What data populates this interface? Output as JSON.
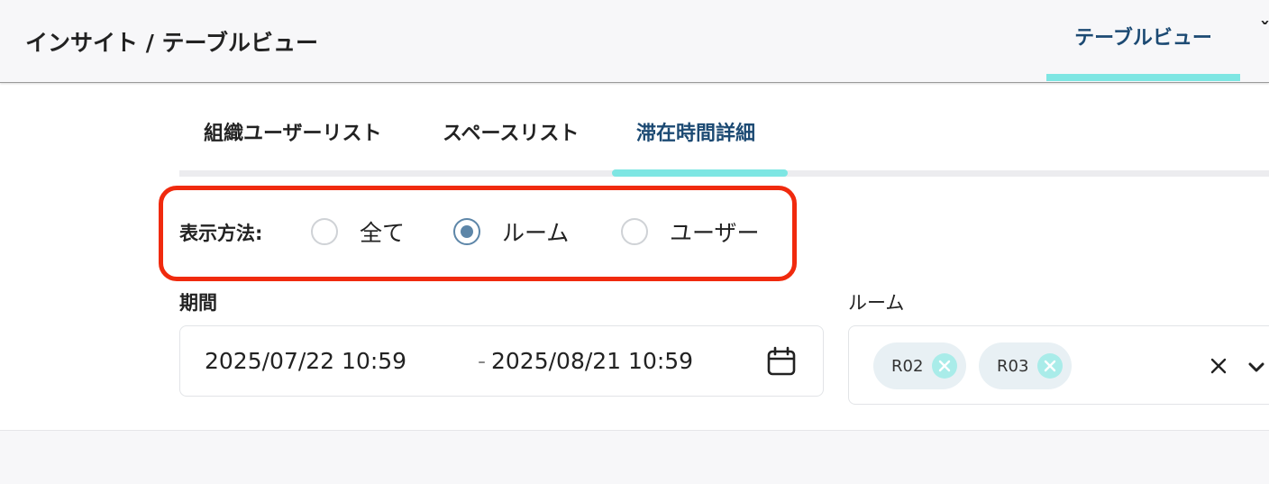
{
  "header": {
    "breadcrumb": "インサイト / テーブルビュー",
    "active_tab": "テーブルビュー"
  },
  "subtabs": [
    {
      "label": "組織ユーザーリスト"
    },
    {
      "label": "スペースリスト"
    },
    {
      "label": "滞在時間詳細"
    }
  ],
  "display_method": {
    "label": "表示方法:",
    "options": [
      {
        "label": "全て",
        "checked": false
      },
      {
        "label": "ルーム",
        "checked": true
      },
      {
        "label": "ユーザー",
        "checked": false
      }
    ]
  },
  "period": {
    "label": "期間",
    "start": "2025/07/22 10:59",
    "separator": "-",
    "end": "2025/08/21 10:59"
  },
  "room": {
    "label": "ルーム",
    "chips": [
      "R02",
      "R03"
    ]
  },
  "colors": {
    "accent": "#7ee6e3",
    "active_text": "#1c4a73",
    "highlight": "#f02a0e",
    "radio_checked": "#5d86a8"
  },
  "icons": [
    "calendar-icon",
    "chip-remove-icon",
    "clear-icon",
    "chevron-down-icon"
  ]
}
